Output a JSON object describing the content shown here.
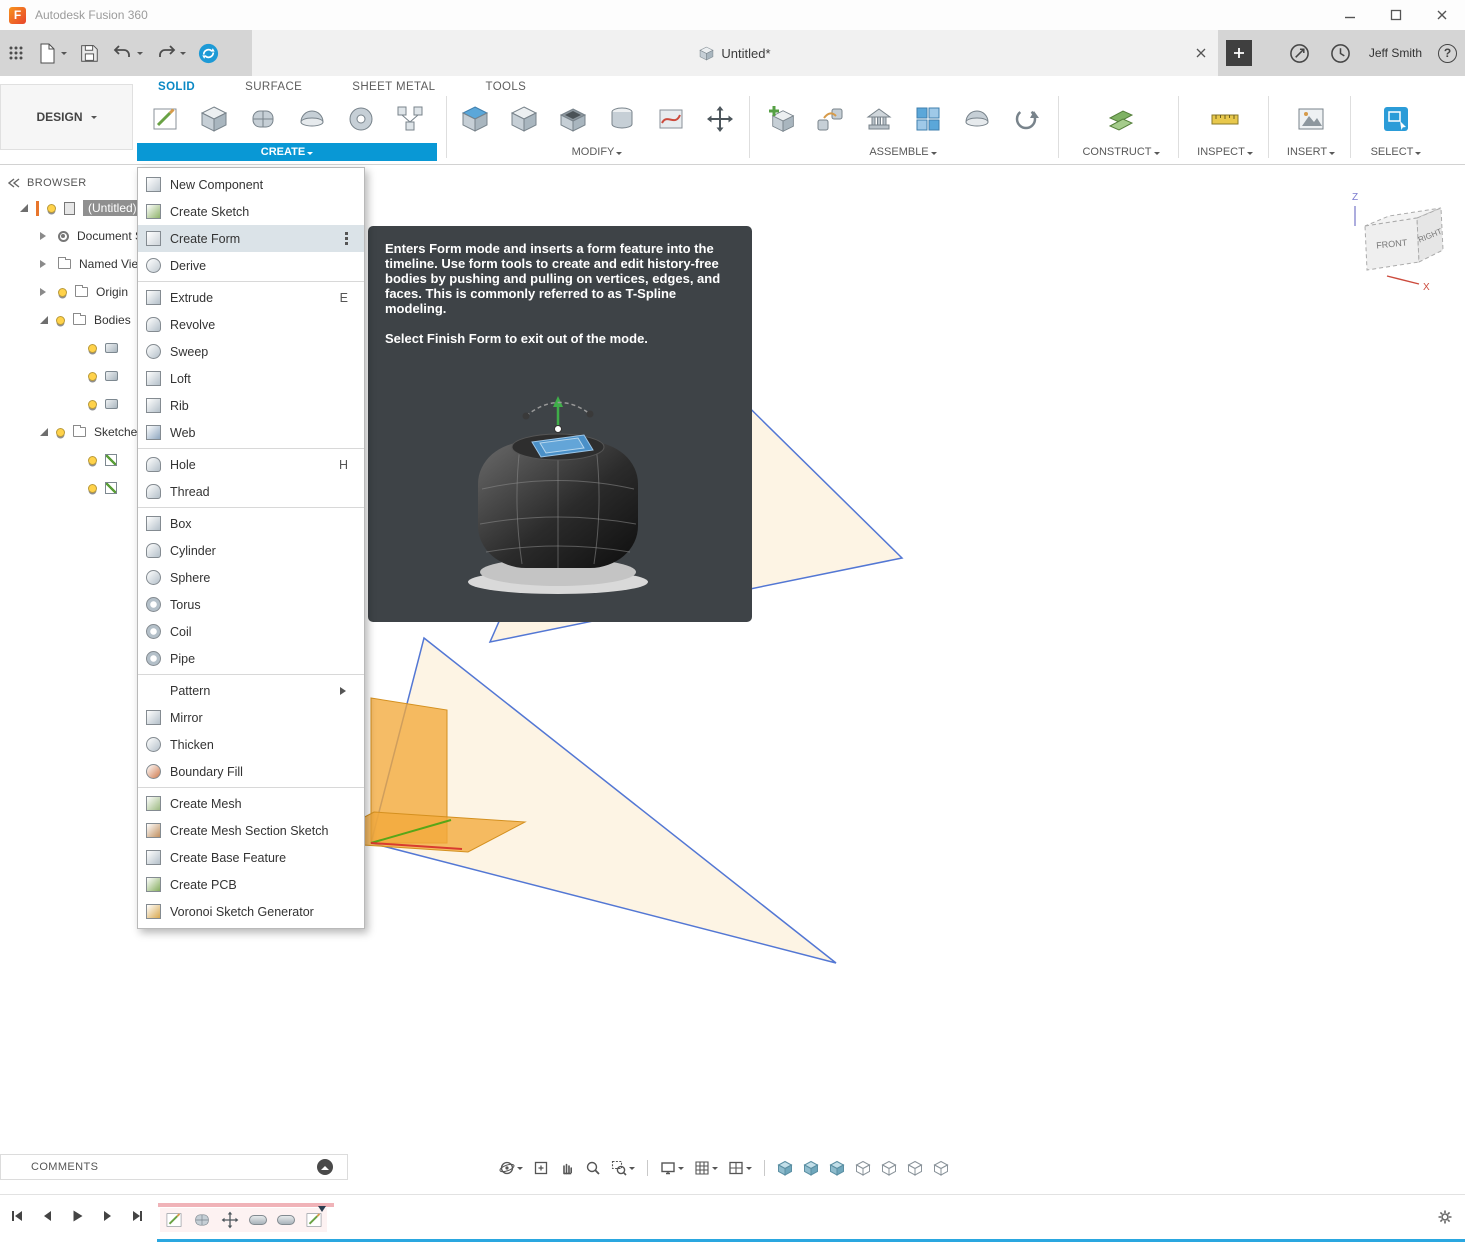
{
  "titlebar": {
    "app_title": "Autodesk Fusion 360"
  },
  "appbar": {
    "document_tab_title": "Untitled*",
    "user_name": "Jeff Smith",
    "help_label": "?"
  },
  "ribbon": {
    "workspace_label": "DESIGN",
    "tabs": [
      {
        "label": "SOLID",
        "active": true
      },
      {
        "label": "SURFACE",
        "active": false
      },
      {
        "label": "SHEET METAL",
        "active": false
      },
      {
        "label": "TOOLS",
        "active": false
      }
    ],
    "group_labels": {
      "create": "CREATE",
      "modify": "MODIFY",
      "assemble": "ASSEMBLE",
      "construct": "CONSTRUCT",
      "inspect": "INSPECT",
      "insert": "INSERT",
      "select": "SELECT"
    }
  },
  "browser": {
    "panel_title": "BROWSER",
    "rows": [
      {
        "label": "(Untitled)",
        "level": 0,
        "expand": "open",
        "icons": [
          "active-bar",
          "bulb",
          "document"
        ],
        "selected": true
      },
      {
        "label": "Document Settings",
        "level": 1,
        "expand": "closed",
        "icons": [
          "gear"
        ]
      },
      {
        "label": "Named Views",
        "level": 1,
        "expand": "closed",
        "icons": [
          "folder"
        ]
      },
      {
        "label": "Origin",
        "level": 1,
        "expand": "closed",
        "icons": [
          "bulb",
          "folder"
        ]
      },
      {
        "label": "Bodies",
        "level": 1,
        "expand": "open",
        "icons": [
          "bulb",
          "folder"
        ]
      },
      {
        "label": "",
        "level": 2,
        "icons": [
          "bulb",
          "body"
        ]
      },
      {
        "label": "",
        "level": 2,
        "icons": [
          "bulb",
          "body"
        ]
      },
      {
        "label": "",
        "level": 2,
        "icons": [
          "bulb",
          "body"
        ]
      },
      {
        "label": "Sketches",
        "level": 1,
        "expand": "open",
        "icons": [
          "bulb",
          "folder"
        ]
      },
      {
        "label": "",
        "level": 2,
        "icons": [
          "bulb",
          "sketch"
        ]
      },
      {
        "label": "",
        "level": 2,
        "icons": [
          "bulb",
          "sketch"
        ]
      }
    ]
  },
  "create_menu": {
    "items": [
      {
        "label": "New Component",
        "icon": "new-component"
      },
      {
        "label": "Create Sketch",
        "icon": "create-sketch"
      },
      {
        "label": "Create Form",
        "icon": "create-form",
        "selected": true,
        "more": true
      },
      {
        "label": "Derive",
        "icon": "derive"
      },
      {
        "label": "Extrude",
        "icon": "extrude",
        "shortcut": "E",
        "group_start": true
      },
      {
        "label": "Revolve",
        "icon": "revolve"
      },
      {
        "label": "Sweep",
        "icon": "sweep"
      },
      {
        "label": "Loft",
        "icon": "loft"
      },
      {
        "label": "Rib",
        "icon": "rib"
      },
      {
        "label": "Web",
        "icon": "web"
      },
      {
        "label": "Hole",
        "icon": "hole",
        "shortcut": "H",
        "group_start": true
      },
      {
        "label": "Thread",
        "icon": "thread"
      },
      {
        "label": "Box",
        "icon": "box",
        "group_start": true
      },
      {
        "label": "Cylinder",
        "icon": "cylinder"
      },
      {
        "label": "Sphere",
        "icon": "sphere"
      },
      {
        "label": "Torus",
        "icon": "torus"
      },
      {
        "label": "Coil",
        "icon": "coil"
      },
      {
        "label": "Pipe",
        "icon": "pipe"
      },
      {
        "label": "Pattern",
        "submenu": true,
        "group_start": true
      },
      {
        "label": "Mirror",
        "icon": "mirror"
      },
      {
        "label": "Thicken",
        "icon": "thicken"
      },
      {
        "label": "Boundary Fill",
        "icon": "boundary-fill"
      },
      {
        "label": "Create Mesh",
        "icon": "create-mesh",
        "group_start": true
      },
      {
        "label": "Create Mesh Section Sketch",
        "icon": "create-mesh-section-sketch"
      },
      {
        "label": "Create Base Feature",
        "icon": "create-base-feature"
      },
      {
        "label": "Create PCB",
        "icon": "create-pcb"
      },
      {
        "label": "Voronoi Sketch Generator",
        "icon": "voronoi-sketch-generator"
      }
    ]
  },
  "form_tooltip": {
    "body": "Enters Form mode and inserts a form feature into the timeline. Use form tools to create and edit history-free bodies by pushing and pulling on vertices, edges, and faces. This is commonly referred to as T-Spline modeling.",
    "footer": "Select Finish Form to exit out of the mode."
  },
  "viewcube": {
    "z_label": "Z",
    "x_label": "X",
    "front_label": "FRONT",
    "right_label": "RIGHT"
  },
  "comments": {
    "label": "COMMENTS"
  },
  "colors": {
    "accent_blue": "#0998d5",
    "plane_fill": "#fdf4e4",
    "plane_stroke": "#5377d4",
    "construction_orange": "#f2a93b",
    "tooltip_bg": "#3e4347"
  }
}
